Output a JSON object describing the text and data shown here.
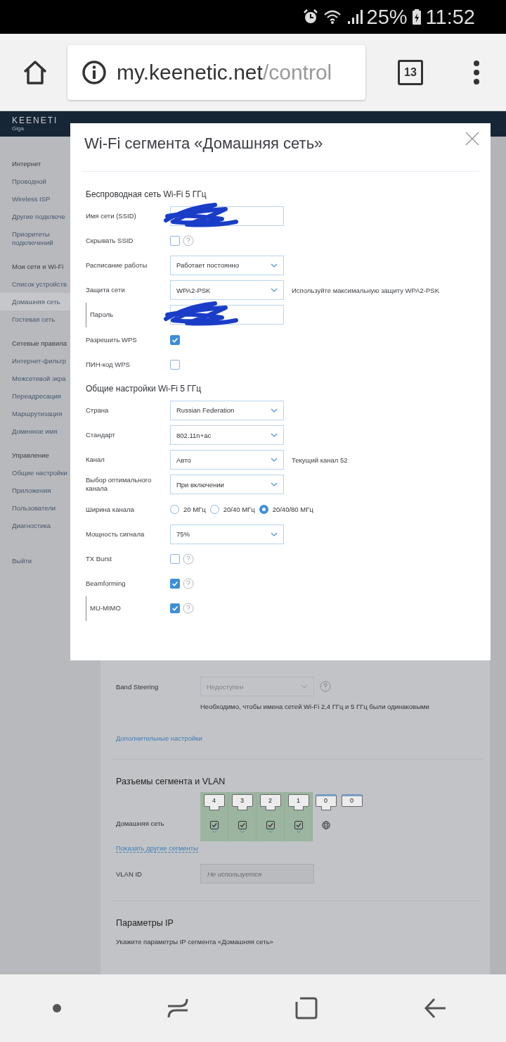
{
  "status_bar": {
    "battery": "25%",
    "time": "11:52"
  },
  "browser": {
    "url_host": "my.keenetic.net",
    "url_path": "/control",
    "tab_count": "13"
  },
  "app": {
    "logo": "KEENETI",
    "model": "Giga"
  },
  "sidebar": {
    "groups": [
      {
        "title": "Интернет",
        "items": [
          {
            "label": "Проводной",
            "selected": false
          },
          {
            "label": "Wireless ISP",
            "selected": false
          },
          {
            "label": "Другие подключе",
            "selected": false
          },
          {
            "label": "Приоритеты подключений",
            "selected": false
          }
        ]
      },
      {
        "title": "Мои сети и Wi-Fi",
        "items": [
          {
            "label": "Список устройств",
            "selected": false
          },
          {
            "label": "Домашняя сеть",
            "selected": true
          },
          {
            "label": "Гостевая сеть",
            "selected": false
          }
        ]
      },
      {
        "title": "Сетевые правила",
        "items": [
          {
            "label": "Интернет-фильтр",
            "selected": false
          },
          {
            "label": "Межсетевой экра",
            "selected": false
          },
          {
            "label": "Переадресация",
            "selected": false
          },
          {
            "label": "Маршрутизация",
            "selected": false
          },
          {
            "label": "Доменное имя",
            "selected": false
          }
        ]
      },
      {
        "title": "Управление",
        "items": [
          {
            "label": "Общие настройки",
            "selected": false
          },
          {
            "label": "Приложения",
            "selected": false
          },
          {
            "label": "Пользователи",
            "selected": false
          },
          {
            "label": "Диагностика",
            "selected": false
          }
        ]
      },
      {
        "items": [
          {
            "label": "Выйти",
            "selected": false
          }
        ]
      }
    ]
  },
  "page": {
    "band_steering": {
      "label": "Band Steering",
      "value": "Недоступен",
      "disabled": true,
      "help": true,
      "note": "Необходимо, чтобы имена сетей Wi-Fi 2,4 ГГц и 5 ГГц были одинаковыми"
    },
    "advanced_link": "Дополнительные настройки",
    "ports_section": {
      "title": "Разъемы сегмента и VLAN",
      "row_label": "Домашняя сеть",
      "ports": [
        {
          "label": "4",
          "kind": "lan",
          "included": true
        },
        {
          "label": "3",
          "kind": "lan",
          "included": true
        },
        {
          "label": "2",
          "kind": "lan",
          "included": true
        },
        {
          "label": "1",
          "kind": "lan",
          "included": true
        },
        {
          "label": "0",
          "kind": "wan",
          "included": false
        },
        {
          "label": "0",
          "kind": "other",
          "included": false
        }
      ],
      "show_link": "Показать другие сегменты",
      "vlan_label": "VLAN ID",
      "vlan_placeholder": "Не используется"
    },
    "ip_section": {
      "title": "Параметры IP",
      "text": "Укажите параметры IP сегмента «Домашняя сеть»"
    }
  },
  "modal": {
    "title": "Wi-Fi сегмента «Домашняя сеть»",
    "sections": [
      {
        "title": "Беспроводная сеть Wi-Fi 5 ГГц",
        "rows": [
          {
            "kind": "text",
            "label": "Имя сети (SSID)",
            "redacted": true,
            "nested": false
          },
          {
            "kind": "checkbox",
            "label": "Скрывать SSID",
            "checked": false,
            "help": true,
            "nested": false
          },
          {
            "kind": "select",
            "label": "Расписание работы",
            "value": "Работает постоянно",
            "nested": false
          },
          {
            "kind": "select",
            "label": "Защита сети",
            "value": "WPA2-PSK",
            "note": "Используйте максимальную защиту WPA2-PSK",
            "nested": false
          },
          {
            "kind": "text",
            "label": "Пароль",
            "redacted": true,
            "nested": true
          },
          {
            "kind": "checkbox",
            "label": "Разрешить WPS",
            "checked": true,
            "help": false,
            "nested": false
          },
          {
            "kind": "checkbox",
            "label": "ПИН-код WPS",
            "checked": false,
            "help": false,
            "nested": false
          }
        ]
      },
      {
        "title": "Общие настройки Wi-Fi 5 ГГц",
        "rows": [
          {
            "kind": "select",
            "label": "Страна",
            "value": "Russian Federation",
            "nested": false
          },
          {
            "kind": "select",
            "label": "Стандарт",
            "value": "802.11n+ac",
            "nested": false
          },
          {
            "kind": "select",
            "label": "Канал",
            "value": "Авто",
            "note": "Текущий канал 52",
            "nested": false
          },
          {
            "kind": "select",
            "label": "Выбор оптимального канала",
            "value": "При включении",
            "nested": false
          },
          {
            "kind": "radio",
            "label": "Ширина канала",
            "options": [
              {
                "label": "20 МГц",
                "selected": false
              },
              {
                "label": "20/40 МГц",
                "selected": false
              },
              {
                "label": "20/40/80 МГц",
                "selected": true
              }
            ],
            "nested": false
          },
          {
            "kind": "select",
            "label": "Мощность сигнала",
            "value": "75%",
            "nested": false
          },
          {
            "kind": "checkbox",
            "label": "TX Burst",
            "checked": false,
            "help": true,
            "nested": false
          },
          {
            "kind": "checkbox",
            "label": "Beamforming",
            "checked": true,
            "help": true,
            "nested": false
          },
          {
            "kind": "checkbox",
            "label": "MU-MIMO",
            "checked": true,
            "help": true,
            "nested": true
          }
        ]
      }
    ]
  }
}
